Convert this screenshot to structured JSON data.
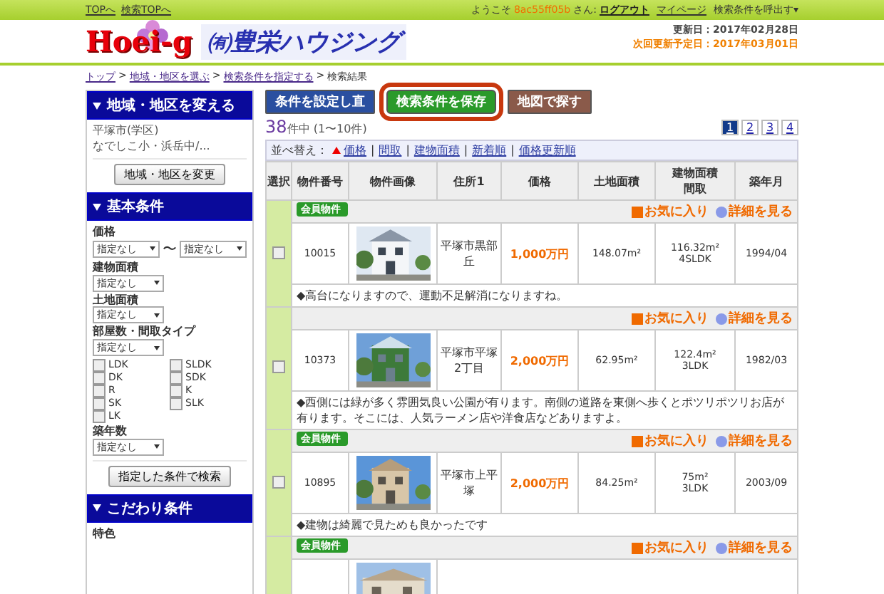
{
  "top_bar": {
    "links": [
      "TOPへ",
      "検索TOPへ"
    ],
    "welcome": "ようこそ",
    "user": "8ac55ff05b",
    "user_suffix": "さん:",
    "logout": "ログアウト",
    "mypage": "マイページ",
    "recall": "検索条件を呼出す▾"
  },
  "header": {
    "logo_text": "Hoei-g",
    "company": "㈲豊栄ハウジング",
    "updated": "更新日：2017年02月28日",
    "next_update": "次回更新予定日：2017年03月01日"
  },
  "breadcrumb": [
    {
      "label": "トップ",
      "link": true
    },
    {
      "separator": ">",
      "label": "地域・地区を選ぶ",
      "link": true
    },
    {
      "separator": ">",
      "label": "検索条件を指定する",
      "link": true
    },
    {
      "separator": ">",
      "label": "検索結果",
      "link": false
    }
  ],
  "sidebar": {
    "area_panel": {
      "title": "地域・地区を変える",
      "lines": [
        "平塚市(学区)",
        "なでしこ小・浜岳中/..."
      ],
      "button": "地域・地区を変更"
    },
    "basic_panel": {
      "title": "基本条件",
      "price_label": "価格",
      "price_from": "指定なし",
      "range_sep": "〜",
      "price_to": "指定なし",
      "building_label": "建物面積",
      "building": "指定なし",
      "land_label": "土地面積",
      "land": "指定なし",
      "rooms_label": "部屋数・間取タイプ",
      "rooms": "指定なし",
      "layouts": [
        {
          "label": "LDK",
          "checked": false
        },
        {
          "label": "SLDK",
          "checked": false
        },
        {
          "label": "DK",
          "checked": false
        },
        {
          "label": "SDK",
          "checked": false
        },
        {
          "label": "R",
          "checked": false
        },
        {
          "label": "K",
          "checked": false
        },
        {
          "label": "SK",
          "checked": false
        },
        {
          "label": "SLK",
          "checked": false
        },
        {
          "label": "LK",
          "checked": false
        }
      ],
      "age_label": "築年数",
      "age": "指定なし",
      "search_button": "指定した条件で検索"
    },
    "extra_panel": {
      "title": "こだわり条件",
      "feature_label": "特色"
    }
  },
  "actions": [
    {
      "label": "条件を設定し直",
      "kind": "reset",
      "highlighted": false
    },
    {
      "label": "検索条件を保存",
      "kind": "save",
      "highlighted": true
    },
    {
      "label": "地図で探す",
      "kind": "map",
      "highlighted": false
    }
  ],
  "results": {
    "count": "38",
    "count_suffix": "件中 (1〜10件)",
    "pages": [
      {
        "label": "1",
        "selected": true
      },
      {
        "label": "2",
        "selected": false
      },
      {
        "label": "3",
        "selected": false
      },
      {
        "label": "4",
        "selected": false
      }
    ]
  },
  "sort": {
    "label": "並べ替え：",
    "options": [
      {
        "label": "価格",
        "active": true
      },
      {
        "separator": "|",
        "label": "間取",
        "active": false
      },
      {
        "separator": "|",
        "label": "建物面積",
        "active": false
      },
      {
        "separator": "|",
        "label": "新着順",
        "active": false
      },
      {
        "separator": "|",
        "label": "価格更新順",
        "active": false
      }
    ]
  },
  "table": {
    "columns": [
      "選択",
      "物件番号",
      "物件画像",
      "住所1",
      "価格",
      "土地面積",
      "建物面積間取",
      "築年月"
    ],
    "rows": [
      {
        "member": true,
        "badge": "会員物件",
        "favorite": "お気に入り",
        "detail": "詳細を見る",
        "checked": false,
        "number": "10015",
        "address": "平塚市黒部丘",
        "price": "1,000万円",
        "land_area": "148.07m²",
        "building_area": "116.32m²",
        "layout": "4SLDK",
        "built": "1994/04",
        "comment": "◆高台になりますので、運動不足解消になりますね。"
      },
      {
        "member": false,
        "favorite": "お気に入り",
        "detail": "詳細を見る",
        "checked": false,
        "number": "10373",
        "address": "平塚市平塚2丁目",
        "price": "2,000万円",
        "land_area": "62.95m²",
        "building_area": "122.4m²",
        "layout": "3LDK",
        "built": "1982/03",
        "comment": "◆西側には緑が多く雰囲気良い公園が有ります。南側の道路を東側へ歩くとポツリポツリお店が有ります。そこには、人気ラーメン店や洋食店などありますよ。"
      },
      {
        "member": true,
        "badge": "会員物件",
        "favorite": "お気に入り",
        "detail": "詳細を見る",
        "checked": false,
        "number": "10895",
        "address": "平塚市上平塚",
        "price": "2,000万円",
        "land_area": "84.25m²",
        "building_area": "75m²",
        "layout": "3LDK",
        "built": "2003/09",
        "comment": "◆建物は綺麗で見ためも良かったです"
      },
      {
        "member": true,
        "badge": "会員物件",
        "favorite": "お気に入り",
        "detail": "詳細を見る"
      }
    ]
  }
}
